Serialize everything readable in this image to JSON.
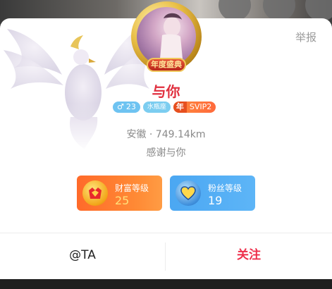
{
  "profile": {
    "report_label": "举报",
    "avatar_badge": "年度盛典",
    "username": "与你",
    "tags": {
      "gender_symbol": "♂",
      "age": "23",
      "zodiac": "水瓶座",
      "vip_prefix": "年",
      "vip_level": "SVIP2"
    },
    "location": "安徽 · 749.14km",
    "signature": "感谢与你"
  },
  "levels": {
    "wealth": {
      "label": "财富等级",
      "value": "25",
      "icon": "crown-gem-icon"
    },
    "fans": {
      "label": "粉丝等级",
      "value": "19",
      "icon": "heart-gem-icon"
    }
  },
  "actions": {
    "at_label": "@TA",
    "follow_label": "关注"
  },
  "colors": {
    "username": "#e0303f",
    "follow": "#ee2f4b",
    "wealth_card": "#ff7a30",
    "fans_card": "#55aff5"
  }
}
